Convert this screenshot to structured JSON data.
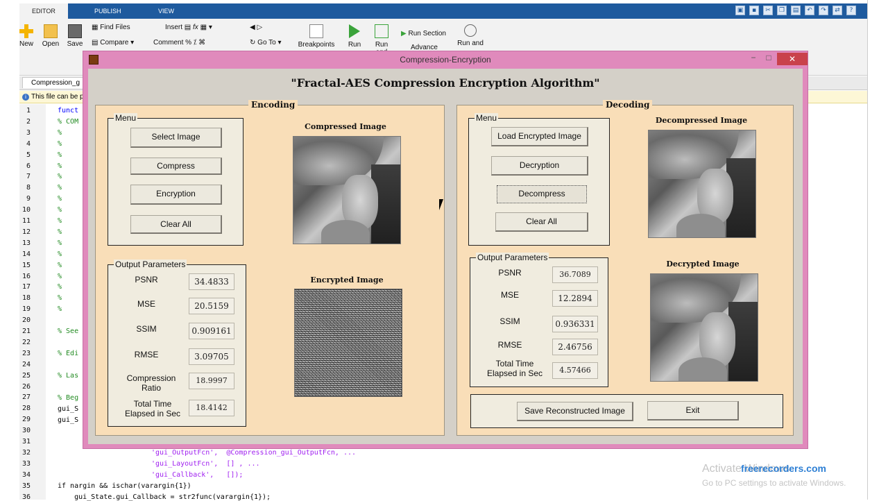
{
  "matlab": {
    "tabs": [
      "EDITOR",
      "PUBLISH",
      "VIEW"
    ],
    "ribbon": {
      "new": "New",
      "open": "Open",
      "save": "Save",
      "find_files": "Find Files",
      "compare": "Compare",
      "insert": "Insert",
      "comment": "Comment",
      "go_to": "Go To",
      "breakpoints": "Breakpoints",
      "run": "Run",
      "run_and": "Run and",
      "run_section": "Run Section",
      "advance": "Advance",
      "run_and_time": "Run and",
      "fx": "fx"
    },
    "doc_tab": "Compression_g",
    "info_bar": "This file can be p",
    "line_numbers": [
      "1",
      "2",
      "3",
      "4",
      "5",
      "6",
      "7",
      "8",
      "9",
      "10",
      "11",
      "12",
      "13",
      "14",
      "15",
      "16",
      "17",
      "18",
      "19",
      "20",
      "21",
      "22",
      "23",
      "24",
      "25",
      "26",
      "27",
      "28",
      "29",
      "30",
      "31",
      "32",
      "33",
      "34",
      "35",
      "36"
    ],
    "code": {
      "l1": "funct",
      "l2": "% COM",
      "pct": "%",
      "l21": "% See",
      "l23": "% Edi",
      "l25": "% Las",
      "l27": "% Beg",
      "l28": "gui_S",
      "l29": "gui_S",
      "l32": "'gui_OutputFcn',  @Compression_gui_OutputFcn, ...",
      "l33": "'gui_LayoutFcn',  [] , ...",
      "l34": "'gui_Callback',   []);",
      "l35": "if nargin && ischar(varargin{1})",
      "l36": "    gui_State.gui_Callback = str2func(varargin{1});"
    },
    "watermark_activate": "Activate Windows",
    "watermark_settings": "Go to PC settings to activate Windows.",
    "freerecorders": "freerecorders.com"
  },
  "figure": {
    "window_title": "Compression-Encryption",
    "minimize": "−",
    "maximize": "□",
    "close": "✕",
    "heading": "\"Fractal-AES Compression Encryption Algorithm\"",
    "encoding": {
      "title": "Encoding",
      "menu_title": "Menu",
      "buttons": {
        "select_image": "Select Image",
        "compress": "Compress",
        "encryption": "Encryption",
        "clear_all": "Clear All"
      },
      "compressed_image_title": "Compressed Image",
      "encrypted_image_title": "Encrypted Image",
      "output_title": "Output Parameters",
      "params": {
        "psnr_label": "PSNR",
        "psnr": "34.4833",
        "mse_label": "MSE",
        "mse": "20.5159",
        "ssim_label": "SSIM",
        "ssim": "0.909161",
        "rmse_label": "RMSE",
        "rmse": "3.09705",
        "ratio_label_1": "Compression",
        "ratio_label_2": "Ratio",
        "ratio": "18.9997",
        "time_label_1": "Total Time",
        "time_label_2": "Elapsed in Sec",
        "time": "18.4142"
      }
    },
    "decoding": {
      "title": "Decoding",
      "menu_title": "Menu",
      "buttons": {
        "load_encrypted": "Load Encrypted Image",
        "decryption": "Decryption",
        "decompress": "Decompress",
        "clear_all": "Clear All"
      },
      "decompressed_image_title": "Decompressed Image",
      "decrypted_image_title": "Decrypted Image",
      "output_title": "Output Parameters",
      "params": {
        "psnr_label": "PSNR",
        "psnr": "36.7089",
        "mse_label": "MSE",
        "mse": "12.2894",
        "ssim_label": "SSIM",
        "ssim": "0.936331",
        "rmse_label": "RMSE",
        "rmse": "2.46756",
        "time_label_1": "Total Time",
        "time_label_2": "Elapsed in Sec",
        "time": "4.57466"
      },
      "save_button": "Save Reconstructed Image",
      "exit_button": "Exit"
    }
  }
}
